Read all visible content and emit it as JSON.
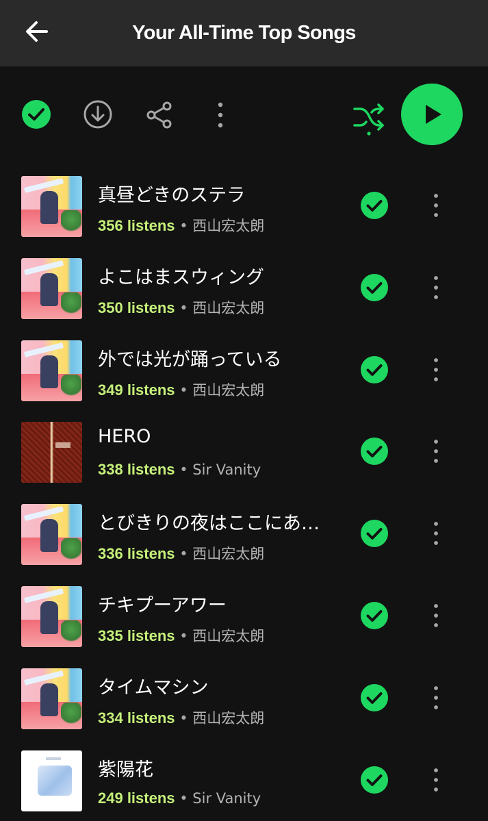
{
  "header": {
    "title": "Your All-Time Top Songs"
  },
  "icons": {
    "back": "arrow-left",
    "downloaded": "check-circle",
    "download": "download-circle",
    "share": "share",
    "more": "more-vertical",
    "shuffle": "shuffle",
    "play": "play"
  },
  "colors": {
    "accent": "#1ed760",
    "listens": "#c5f07a",
    "background": "#121212",
    "header": "#2a2a2a"
  },
  "songs": [
    {
      "title": "真昼どきのステラ",
      "listens": "356 listens",
      "separator": "•",
      "artist": "西山宏太朗",
      "cover": "city-album",
      "downloaded": true
    },
    {
      "title": "よこはまスウィング",
      "listens": "350 listens",
      "separator": "•",
      "artist": "西山宏太朗",
      "cover": "city-album",
      "downloaded": true
    },
    {
      "title": "外では光が踊っている",
      "listens": "349 listens",
      "separator": "•",
      "artist": "西山宏太朗",
      "cover": "city-album",
      "downloaded": true
    },
    {
      "title": "HERO",
      "listens": "338 listens",
      "separator": "•",
      "artist": "Sir Vanity",
      "cover": "hero-album",
      "downloaded": true
    },
    {
      "title": "とびきりの夜はここにあ…",
      "listens": "336 listens",
      "separator": "•",
      "artist": "西山宏太朗",
      "cover": "city-album",
      "downloaded": true
    },
    {
      "title": "チキプーアワー",
      "listens": "335 listens",
      "separator": "•",
      "artist": "西山宏太朗",
      "cover": "city-album",
      "downloaded": true
    },
    {
      "title": "タイムマシン",
      "listens": "334 listens",
      "separator": "•",
      "artist": "西山宏太朗",
      "cover": "city-album",
      "downloaded": true
    },
    {
      "title": "紫陽花",
      "listens": "249 listens",
      "separator": "•",
      "artist": "Sir Vanity",
      "cover": "ajisai-album",
      "downloaded": true
    }
  ]
}
